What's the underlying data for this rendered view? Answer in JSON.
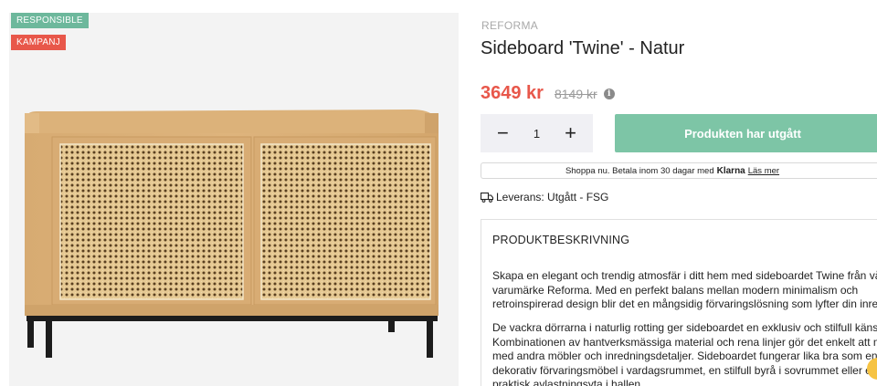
{
  "badges": {
    "responsible": "RESPONSIBLE",
    "campaign": "KAMPANJ"
  },
  "product": {
    "brand": "REFORMA",
    "title": "Sideboard 'Twine' - Natur",
    "price": "3649 kr",
    "old_price": "8149 kr",
    "info_icon": "info-icon"
  },
  "purchase": {
    "minus": "−",
    "quantity": "1",
    "plus": "+",
    "cta_label": "Produkten har utgått"
  },
  "klarna": {
    "text": "Shoppa nu. Betala inom 30 dagar med",
    "logo": "Klarna",
    "link": "Läs mer"
  },
  "delivery": {
    "icon": "truck-icon",
    "text": "Leverans: Utgått - FSG"
  },
  "description": {
    "heading": "PRODUKTBESKRIVNING",
    "paragraph1": [
      "Skapa en elegant och trendig atmosfär i ditt hem med sideboardet Twine från vå",
      "varumärke Reforma. Med en perfekt balans mellan modern minimalism och",
      "retroinspirerad design blir det en mångsidig förvaringslösning som lyfter din inre"
    ],
    "paragraph2": [
      "De vackra dörrarna i naturlig rotting ger sideboardet en exklusiv och stilfull käns",
      "Kombinationen av hantverksmässiga material och rena linjer gör det enkelt att m",
      "med andra möbler och inredningsdetaljer. Sideboardet fungerar lika bra som en",
      "dekorativ förvaringsmöbel i vardagsrummet, en stilfull byrå i sovrummet eller e",
      "praktisk avlastningsyta i hallen."
    ]
  },
  "colors": {
    "sale_red": "#e8574a",
    "cta_green": "#7dc5a6",
    "badge_green": "#6db89c",
    "oak": "#d9b27a",
    "rattan": "#e3c48e"
  }
}
